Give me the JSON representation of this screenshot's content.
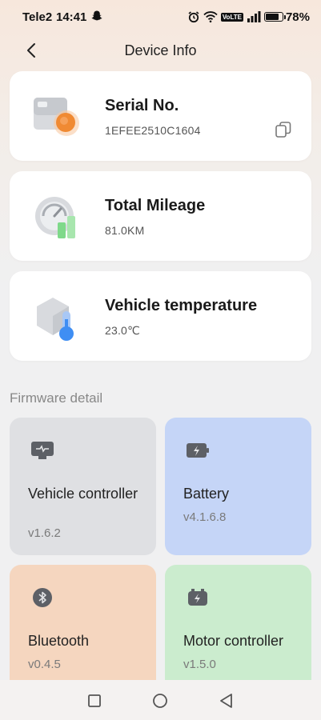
{
  "status_bar": {
    "carrier": "Tele2",
    "time": "14:41",
    "volte": "VoLTE",
    "battery_percent": "78%",
    "battery_level": 0.78
  },
  "header": {
    "title": "Device Info"
  },
  "info_cards": [
    {
      "title": "Serial No.",
      "value": "1EFEE2510C1604",
      "icon": "serial-card-icon"
    },
    {
      "title": "Total Mileage",
      "value": "81.0KM",
      "icon": "speedometer-icon"
    },
    {
      "title": "Vehicle temperature",
      "value": "23.0℃",
      "icon": "thermometer-icon"
    }
  ],
  "firmware": {
    "section_title": "Firmware detail",
    "items": [
      {
        "name": "Vehicle controller",
        "version": "v1.6.2",
        "icon": "controller-icon",
        "color": "#dfe0e3"
      },
      {
        "name": "Battery",
        "version": "v4.1.6.8",
        "icon": "battery-icon",
        "color": "#c5d5f7"
      },
      {
        "name": "Bluetooth",
        "version": "v0.4.5",
        "icon": "bluetooth-icon",
        "color": "#f5d6bf"
      },
      {
        "name": "Motor controller",
        "version": "v1.5.0",
        "icon": "motor-icon",
        "color": "#cbecce"
      }
    ]
  },
  "colors": {
    "orange_accent": "#f08a33",
    "green_accent": "#7fd98a",
    "blue_accent": "#3f8ef3"
  }
}
